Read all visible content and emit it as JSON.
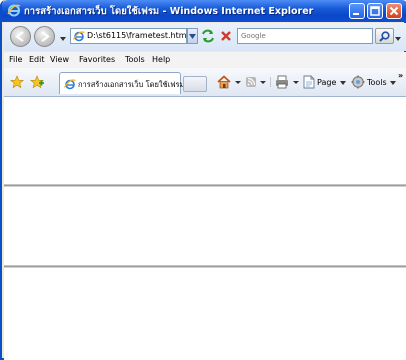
{
  "window": {
    "title": "การสร้างเอกสารเว็บ โดยใช้เฟรม - Windows Internet Explorer"
  },
  "address_bar": {
    "url": "D:\\st6115\\frametest.html",
    "search_placeholder": "Google"
  },
  "menu": {
    "items": [
      "File",
      "Edit",
      "View",
      "Favorites",
      "Tools",
      "Help"
    ]
  },
  "tabs": {
    "active_title": "การสร้างเอกสารเว็บ โดยใช้เฟรม"
  },
  "command_bar": {
    "page_label": "Page",
    "tools_label": "Tools",
    "overflow": "»"
  },
  "colors": {
    "titlebar": "#1659d6",
    "frame_background": "#ffffff"
  },
  "icons": {
    "browser": "ie-logo-icon",
    "back": "back-arrow-icon",
    "forward": "forward-arrow-icon",
    "refresh": "refresh-icon",
    "stop": "stop-icon",
    "search": "magnifier-icon",
    "favorites": "favorites-star-icon",
    "add_favorites": "add-favorites-icon",
    "home": "home-icon",
    "feeds": "feeds-icon",
    "print": "print-icon",
    "page": "page-icon",
    "tools": "gear-icon"
  }
}
